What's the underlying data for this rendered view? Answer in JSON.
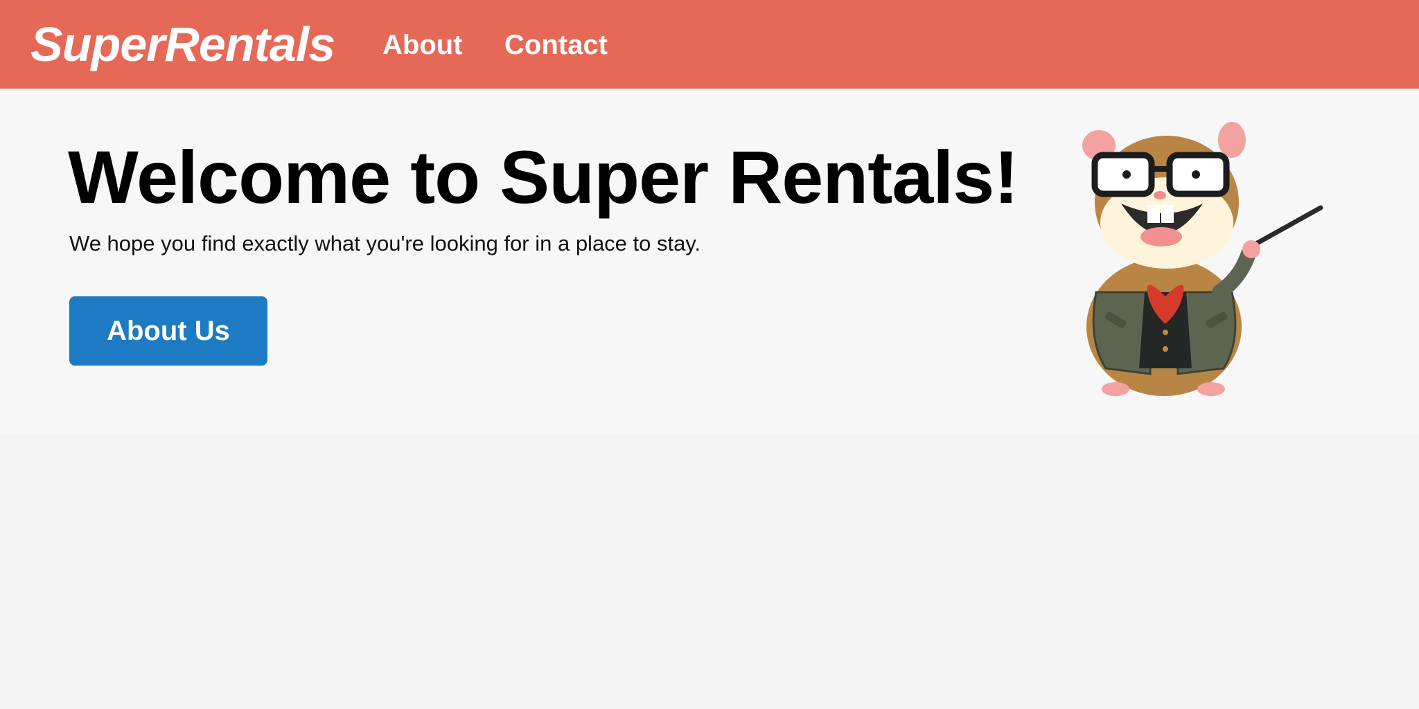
{
  "header": {
    "brand": "SuperRentals",
    "nav": [
      {
        "label": "About"
      },
      {
        "label": "Contact"
      }
    ]
  },
  "hero": {
    "title": "Welcome to Super Rentals!",
    "subtitle": "We hope you find exactly what you're looking for in a place to stay.",
    "button_label": "About Us",
    "mascot": "tomster-hamster-mascot-with-glasses-and-pointer"
  },
  "colors": {
    "header_bg": "#e66958",
    "button_bg": "#1c7bc2",
    "jumbo_bg": "#f7f7f7",
    "page_bg": "#f4f4f4"
  }
}
